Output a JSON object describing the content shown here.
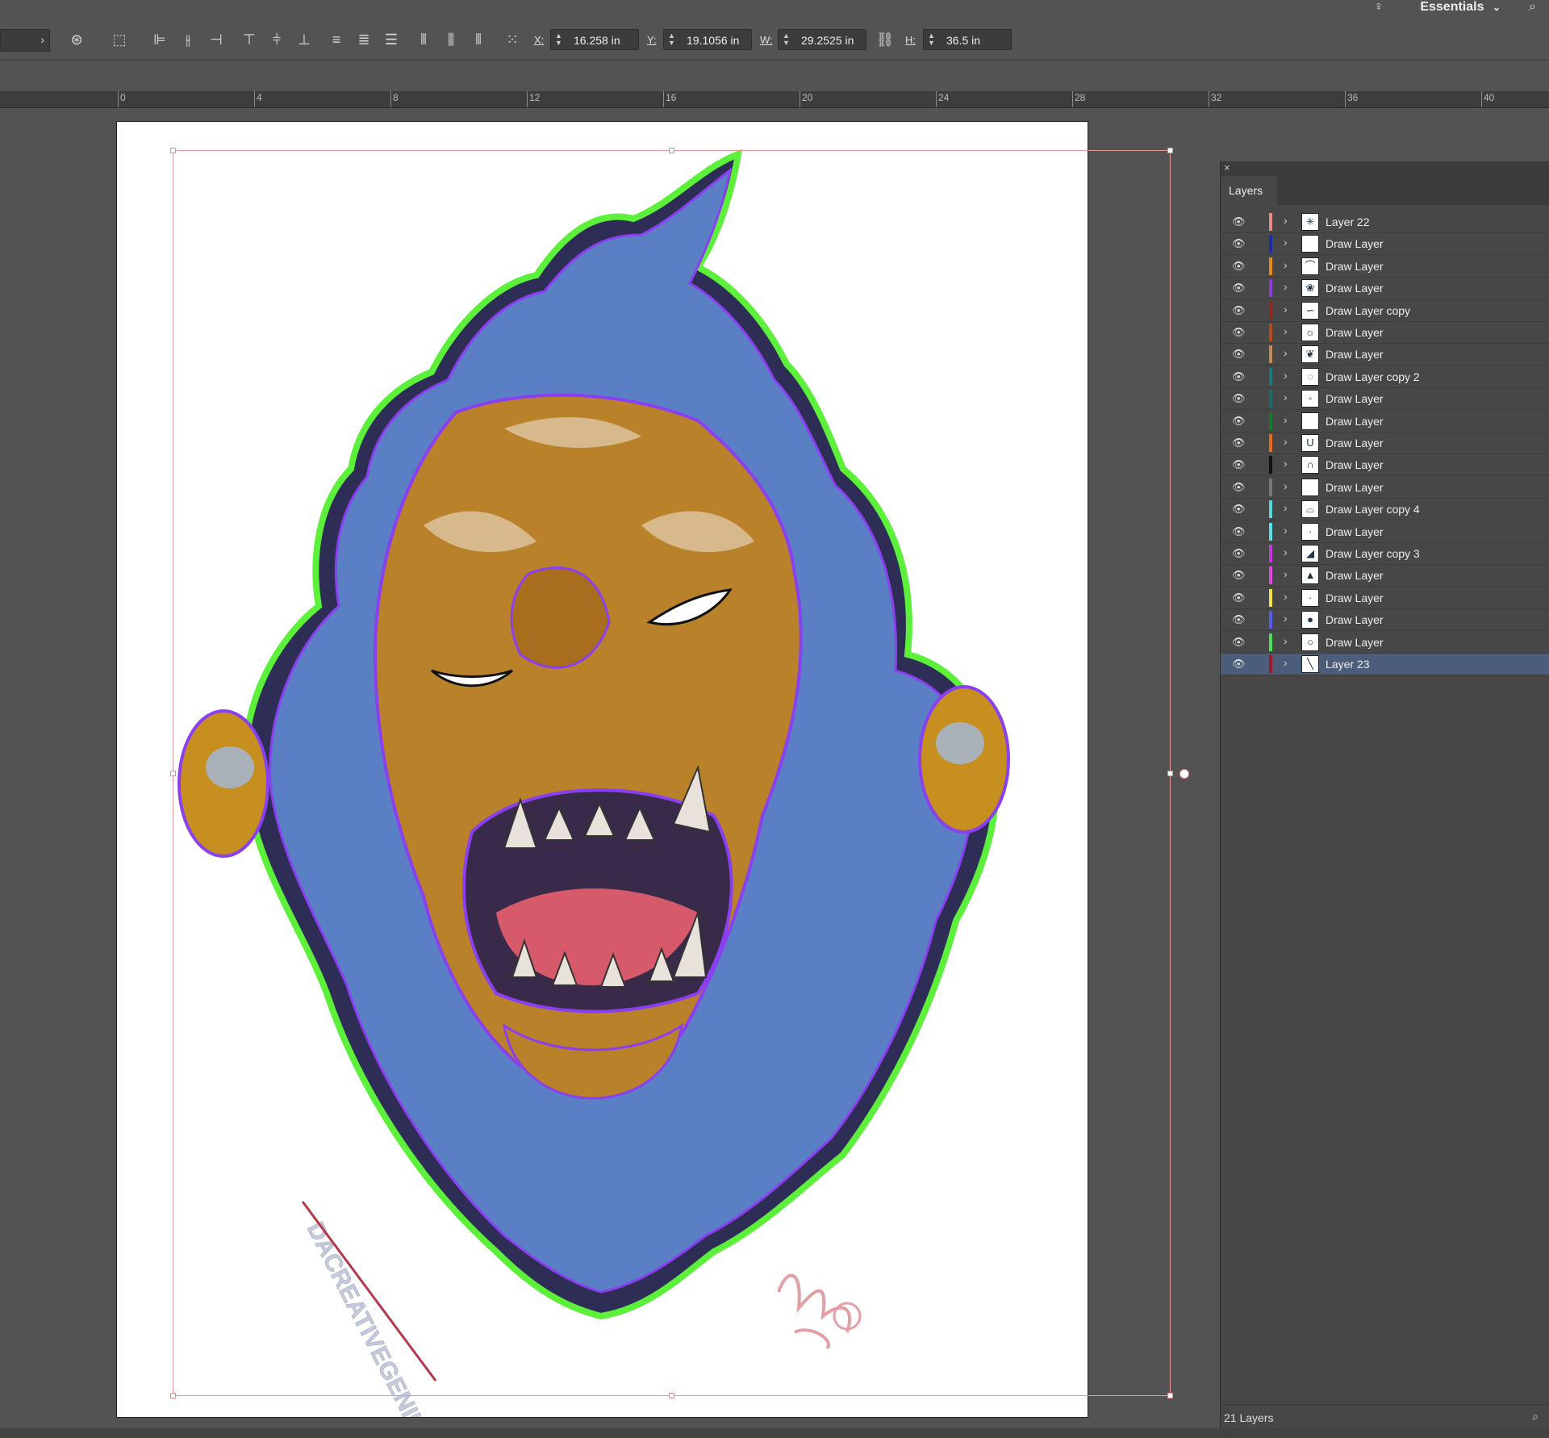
{
  "app": {
    "workspace": "Essentials",
    "chevron": "⌄"
  },
  "toolbar": {
    "x_label": "X:",
    "x_value": "16.258 in",
    "y_label": "Y:",
    "y_value": "19.1056 in",
    "w_label": "W:",
    "w_value": "29.2525 in",
    "h_label": "H:",
    "h_value": "36.5 in"
  },
  "ruler": {
    "labels": [
      "0",
      "4",
      "8",
      "12",
      "16",
      "20",
      "24",
      "28",
      "32",
      "36",
      "40"
    ]
  },
  "artwork": {
    "description_icon": "gorilla-illustration",
    "watermark": "DACREATIVEGENIUS.COM",
    "colors": {
      "fur": "#5b7fc4",
      "face": "#b9822a",
      "outline_green": "#5cf03a",
      "outline_purple": "#8a3ff0",
      "mouth": "#d65a6a",
      "signature": "#e2a0a4"
    }
  },
  "layers_panel": {
    "title": "Layers",
    "count": "21 Layers",
    "items": [
      {
        "name": "Layer 22",
        "color": "#e88888",
        "thumb": "✳"
      },
      {
        "name": "Draw Layer",
        "color": "#1f2aa8",
        "thumb": ""
      },
      {
        "name": "Draw Layer",
        "color": "#e68a1a",
        "thumb": "⌒"
      },
      {
        "name": "Draw Layer",
        "color": "#8b3ad8",
        "thumb": "❀"
      },
      {
        "name": "Draw Layer copy",
        "color": "#8b2a1a",
        "thumb": "∽"
      },
      {
        "name": "Draw Layer",
        "color": "#b24a1a",
        "thumb": "☼"
      },
      {
        "name": "Draw Layer",
        "color": "#c48a5a",
        "thumb": "❦"
      },
      {
        "name": "Draw Layer copy 2",
        "color": "#1a7a7a",
        "thumb": "◌"
      },
      {
        "name": "Draw Layer",
        "color": "#1a6a6a",
        "thumb": "◦"
      },
      {
        "name": "Draw Layer",
        "color": "#1a7a2a",
        "thumb": ""
      },
      {
        "name": "Draw Layer",
        "color": "#e86a1a",
        "thumb": "U"
      },
      {
        "name": "Draw Layer",
        "color": "#111111",
        "thumb": "∩"
      },
      {
        "name": "Draw Layer",
        "color": "#777777",
        "thumb": ""
      },
      {
        "name": "Draw Layer copy 4",
        "color": "#5ad8d8",
        "thumb": "⌓"
      },
      {
        "name": "Draw Layer",
        "color": "#5ae0e8",
        "thumb": "·"
      },
      {
        "name": "Draw Layer copy 3",
        "color": "#c43ad8",
        "thumb": "◢"
      },
      {
        "name": "Draw Layer",
        "color": "#e04ae0",
        "thumb": "▲"
      },
      {
        "name": "Draw Layer",
        "color": "#f0e04a",
        "thumb": "·"
      },
      {
        "name": "Draw Layer",
        "color": "#5a5ae8",
        "thumb": "●"
      },
      {
        "name": "Draw Layer",
        "color": "#4ae05a",
        "thumb": "○"
      },
      {
        "name": "Layer 23",
        "color": "#9a1a2a",
        "thumb": "╲",
        "selected": true
      }
    ]
  }
}
